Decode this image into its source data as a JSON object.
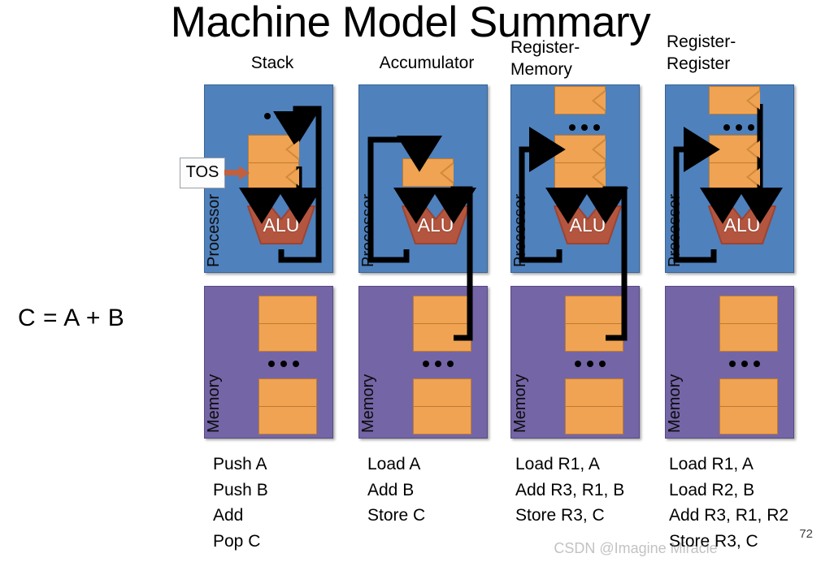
{
  "slide": {
    "title": "Machine Model Summary",
    "equation": "C = A + B",
    "page_number": "72",
    "watermark": "CSDN @Imagine Miracle"
  },
  "labels": {
    "processor": "Processor",
    "memory": "Memory",
    "alu": "ALU",
    "tos": "TOS"
  },
  "colors": {
    "processor_panel": "#4f81bd",
    "memory_panel": "#7465a6",
    "cell": "#f0a352",
    "cell_border": "#c07b2e",
    "alu": "#b4563f",
    "wire": "#000000"
  },
  "columns": [
    {
      "id": "stack",
      "heading": "Stack",
      "instructions": [
        "Push A",
        "Push B",
        "Add",
        "Pop C"
      ]
    },
    {
      "id": "accumulator",
      "heading": "Accumulator",
      "instructions": [
        "Load A",
        "Add B",
        "Store C"
      ]
    },
    {
      "id": "register-memory",
      "heading": "Register-\nMemory",
      "instructions": [
        "Load R1, A",
        "Add R3, R1, B",
        "Store R3, C"
      ]
    },
    {
      "id": "register-register",
      "heading": "Register-\nRegister",
      "instructions": [
        "Load R1, A",
        "Load R2, B",
        "Add R3, R1, R2",
        "Store R3, C"
      ]
    }
  ]
}
